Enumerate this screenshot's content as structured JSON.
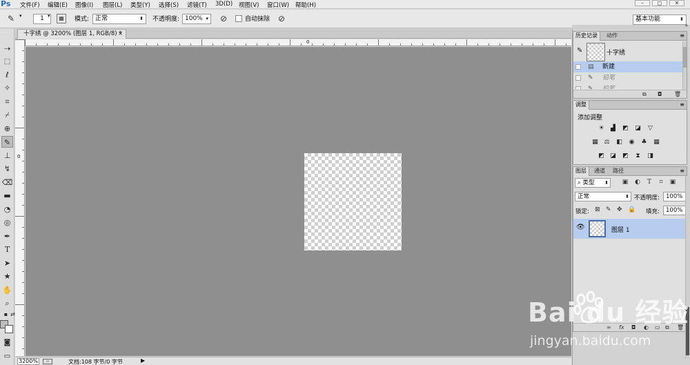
{
  "app": {
    "logo": "Ps"
  },
  "menu": [
    "文件(F)",
    "编辑(E)",
    "图像(I)",
    "图层(L)",
    "类型(Y)",
    "选择(S)",
    "滤镜(T)",
    "3D(D)",
    "视图(V)",
    "窗口(W)",
    "帮助(H)"
  ],
  "window_buttons": [
    "–",
    "◻",
    "✕"
  ],
  "options": {
    "brush_size": "1",
    "mode_label": "模式:",
    "mode_value": "正常",
    "opacity_label": "不透明度:",
    "opacity_value": "100%",
    "auto_erase_label": "自动抹除",
    "workspace": "基本功能"
  },
  "document": {
    "tab_title": "十字绣 @ 3200% (图层 1, RGB/8) *",
    "close_glyph": "×",
    "ruler_top_zero": "0",
    "ruler_left_zero": "0"
  },
  "status": {
    "zoom": "3200%",
    "doc_info": "文档:108 字节/0 字节",
    "arrow": "▶"
  },
  "history_panel": {
    "tabs": [
      "历史记录",
      "动作"
    ],
    "snapshot_label": "十字绣",
    "rows": [
      {
        "label": "新建",
        "selected": true,
        "dim": false
      },
      {
        "label": "铅笔",
        "selected": false,
        "dim": true
      },
      {
        "label": "铅笔",
        "selected": false,
        "dim": true
      }
    ]
  },
  "adjustments_panel": {
    "tabs": [
      "调整"
    ],
    "title": "添加调整"
  },
  "layers_panel": {
    "tabs": [
      "图层",
      "通道",
      "路径"
    ],
    "filter_kind": "类型",
    "blend_mode": "正常",
    "opacity_label": "不透明度:",
    "opacity_value": "100%",
    "lock_label": "锁定:",
    "fill_label": "填充:",
    "fill_value": "100%",
    "layer_name": "图层 1"
  },
  "watermark": {
    "logo": "Bai du 经验",
    "url": "jingyan.baidu.com"
  },
  "colors": {
    "canvas_bg": "#8f8f8f",
    "selection_blue": "#b7cdf0",
    "ps_blue": "#2b6cb8"
  }
}
